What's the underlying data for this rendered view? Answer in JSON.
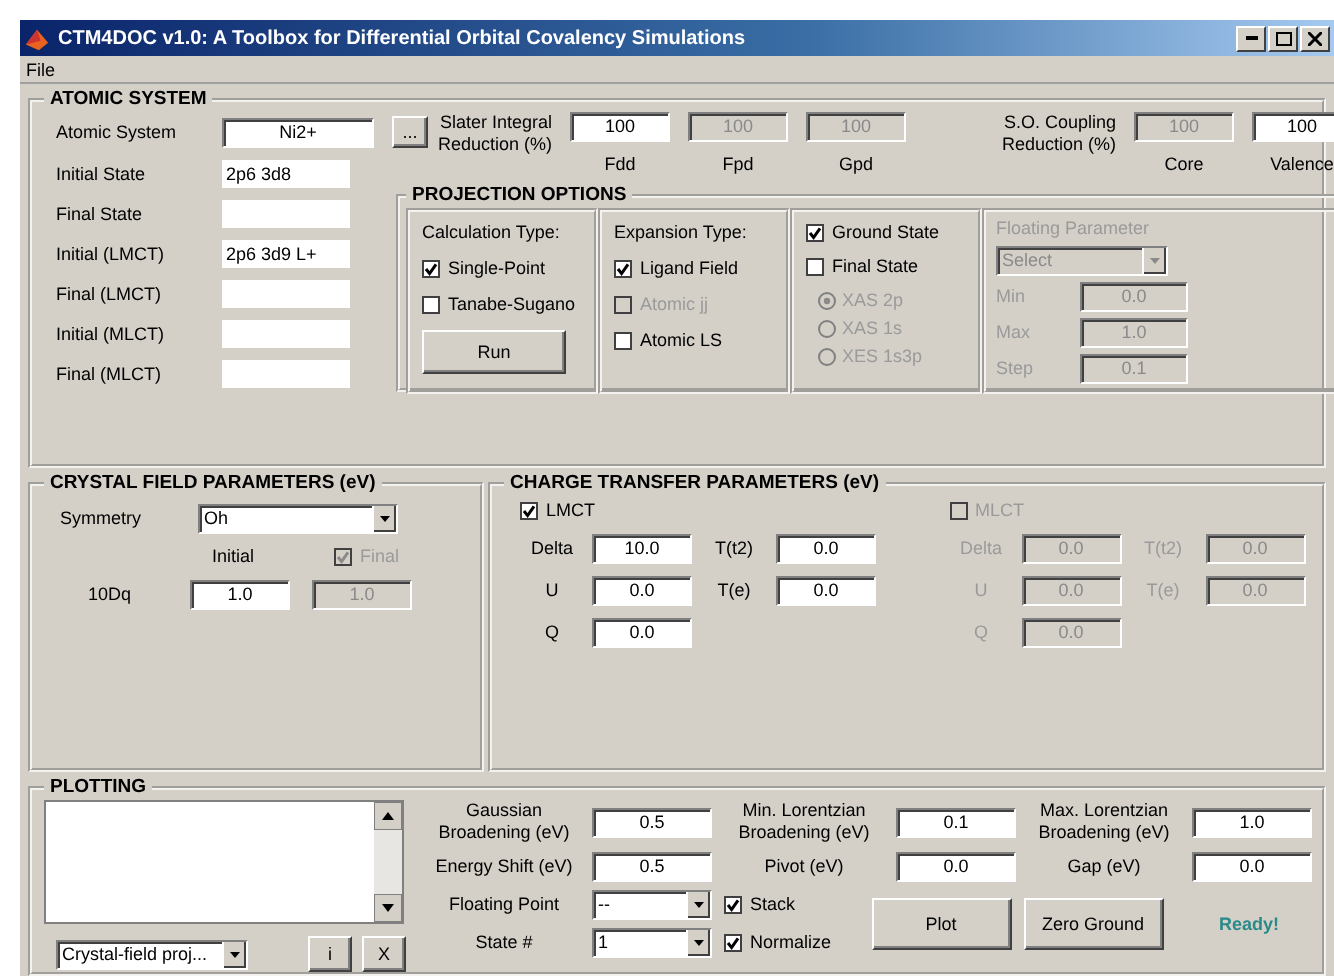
{
  "window": {
    "title": "CTM4DOC v1.0: A Toolbox for Differential Orbital Covalency Simulations"
  },
  "menu": [
    "File"
  ],
  "atomic": {
    "title": "ATOMIC SYSTEM",
    "system": {
      "label": "Atomic System",
      "value": "Ni2+",
      "browse": "..."
    },
    "states": [
      {
        "label": "Initial State",
        "value": "2p6 3d8"
      },
      {
        "label": "Final State"
      },
      {
        "label": "Initial (LMCT)",
        "value": "2p6 3d9 L+"
      },
      {
        "label": "Final (LMCT)"
      },
      {
        "label": "Initial (MLCT)"
      },
      {
        "label": "Final (MLCT)"
      }
    ],
    "slater": {
      "label": "Slater Integral Reduction (%)",
      "inputs": [
        {
          "label": "Fdd",
          "value": "100",
          "disabled": false
        },
        {
          "label": "Fpd",
          "value": "100",
          "disabled": true
        },
        {
          "label": "Gpd",
          "value": "100",
          "disabled": true
        }
      ]
    },
    "so": {
      "label": "S.O. Coupling Reduction (%)",
      "inputs": [
        {
          "label": "Core",
          "value": "100",
          "disabled": true
        },
        {
          "label": "Valence",
          "value": "100",
          "disabled": false
        }
      ]
    }
  },
  "projection": {
    "title": "PROJECTION OPTIONS",
    "calculation": {
      "title": "Calculation Type:",
      "options": [
        {
          "label": "Single-Point",
          "checked": true,
          "disabled": false
        },
        {
          "label": "Tanabe-Sugano",
          "checked": false,
          "disabled": false
        }
      ],
      "run": "Run"
    },
    "expansion": {
      "title": "Expansion Type:",
      "options": [
        {
          "label": "Ligand Field",
          "checked": true,
          "disabled": false
        },
        {
          "label": "Atomic jj",
          "checked": false,
          "disabled": true
        },
        {
          "label": "Atomic LS",
          "checked": false,
          "disabled": false
        }
      ]
    },
    "states": {
      "options": [
        {
          "label": "Ground State",
          "checked": true,
          "disabled": false
        },
        {
          "label": "Final State",
          "checked": false,
          "disabled": false
        }
      ],
      "radios": [
        {
          "label": "XAS 2p",
          "selected": true,
          "disabled": true
        },
        {
          "label": "XAS 1s",
          "selected": false,
          "disabled": true
        },
        {
          "label": "XES 1s3p",
          "selected": false,
          "disabled": true
        }
      ]
    },
    "floating": {
      "title": "Floating Parameter",
      "disabled": true,
      "select": "Select",
      "fields": [
        {
          "label": "Min",
          "value": "0.0"
        },
        {
          "label": "Max",
          "value": "1.0"
        },
        {
          "label": "Step",
          "value": "0.1"
        }
      ]
    }
  },
  "crystal_field": {
    "title": "CRYSTAL FIELD PARAMETERS (eV)",
    "symmetry": {
      "label": "Symmetry",
      "value": "Oh"
    },
    "initial_label": "Initial",
    "final": {
      "label": "Final",
      "checked": true,
      "disabled": true
    },
    "row": {
      "label": "10Dq",
      "initial": "1.0",
      "final": "1.0"
    }
  },
  "charge_transfer": {
    "title": "CHARGE TRANSFER PARAMETERS (eV)",
    "groups": [
      {
        "label": "LMCT",
        "checked": true,
        "disabled": false,
        "params": [
          {
            "label": "Delta",
            "value": "10.0"
          },
          {
            "label": "T(t2)",
            "value": "0.0"
          },
          {
            "label": "U",
            "value": "0.0"
          },
          {
            "label": "T(e)",
            "value": "0.0"
          },
          {
            "label": "Q",
            "value": "0.0"
          }
        ]
      },
      {
        "label": "MLCT",
        "checked": false,
        "disabled": true,
        "params": [
          {
            "label": "Delta",
            "value": "0.0"
          },
          {
            "label": "T(t2)",
            "value": "0.0"
          },
          {
            "label": "U",
            "value": "0.0"
          },
          {
            "label": "T(e)",
            "value": "0.0"
          },
          {
            "label": "Q",
            "value": "0.0"
          }
        ]
      }
    ]
  },
  "plotting": {
    "title": "PLOTTING",
    "mode": "Crystal-field proj...",
    "small_buttons": [
      "i",
      "X"
    ],
    "params": [
      {
        "label": "Gaussian Broadening (eV)",
        "value": "0.5"
      },
      {
        "label": "Min. Lorentzian Broadening (eV)",
        "value": "0.1"
      },
      {
        "label": "Max. Lorentzian Broadening (eV)",
        "value": "1.0"
      },
      {
        "label": "Energy Shift (eV)",
        "value": "0.5"
      },
      {
        "label": "Pivot (eV)",
        "value": "0.0"
      },
      {
        "label": "Gap (eV)",
        "value": "0.0"
      }
    ],
    "selects": [
      {
        "label": "Floating Point",
        "value": "--"
      },
      {
        "label": "State #",
        "value": "1"
      }
    ],
    "checks": [
      {
        "label": "Stack",
        "checked": true
      },
      {
        "label": "Normalize",
        "checked": true
      }
    ],
    "buttons": [
      "Plot",
      "Zero Ground"
    ],
    "status": "Ready!"
  }
}
